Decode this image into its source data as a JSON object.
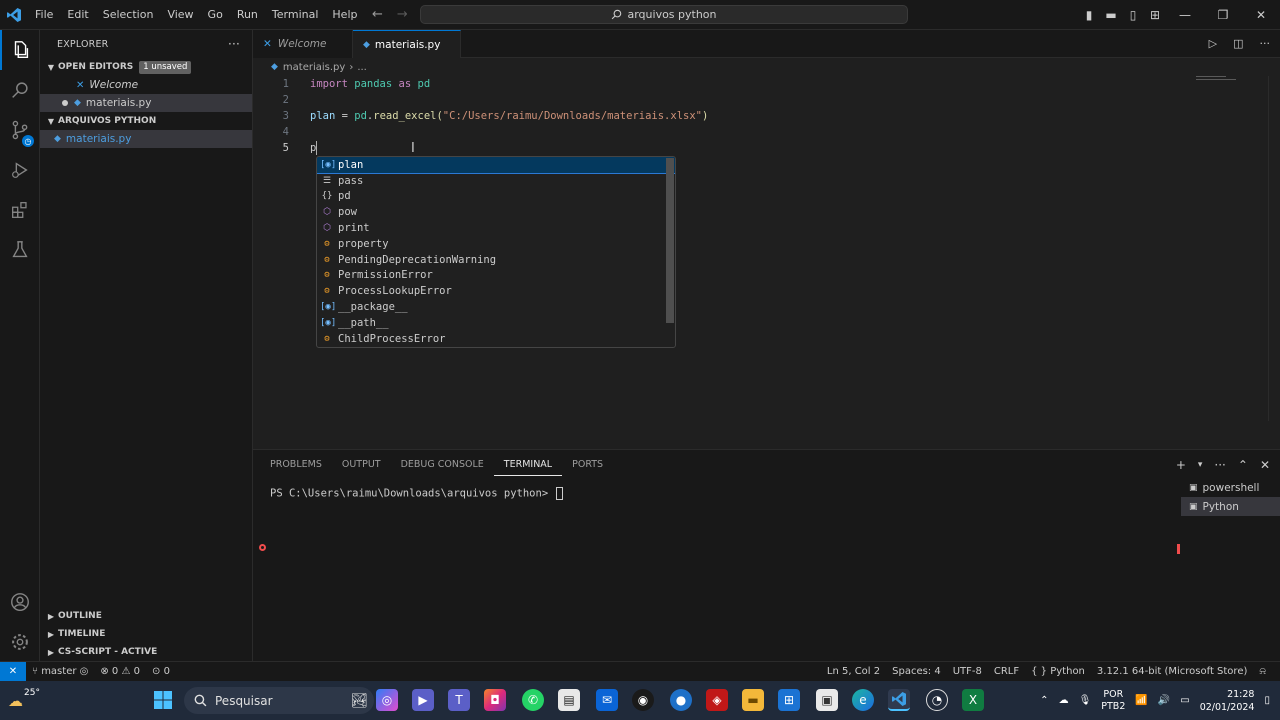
{
  "titlebar": {
    "menu": [
      "File",
      "Edit",
      "Selection",
      "View",
      "Go",
      "Run",
      "Terminal",
      "Help"
    ],
    "search": "arquivos python"
  },
  "sidebar": {
    "title": "EXPLORER",
    "open_editors": "OPEN EDITORS",
    "unsaved_badge": "1 unsaved",
    "open_files": [
      "Welcome",
      "materiais.py"
    ],
    "folder": "ARQUIVOS PYTHON",
    "folder_files": [
      "materiais.py"
    ],
    "outline": "OUTLINE",
    "timeline": "TIMELINE",
    "cs_script": "CS-SCRIPT - ACTIVE"
  },
  "editor": {
    "tabs": [
      "Welcome",
      "materiais.py"
    ],
    "breadcrumb": [
      "materiais.py",
      "..."
    ],
    "line_numbers": [
      "1",
      "2",
      "3",
      "4",
      "5"
    ],
    "line1": {
      "kw1": "import",
      "mod": "pandas",
      "kw2": "as",
      "alias": "pd"
    },
    "line3": {
      "var": "plan",
      "eq": " = ",
      "obj": "pd",
      "dot": ".",
      "fn": "read_excel",
      "open": "(",
      "str": "\"C:/Users/raimu/Downloads/materiais.xlsx\"",
      "close": ")"
    },
    "line5": "p"
  },
  "suggestions": [
    {
      "label": "plan",
      "icon": "variable-icon"
    },
    {
      "label": "pass",
      "icon": "keyword-icon"
    },
    {
      "label": "pd",
      "icon": "module-icon"
    },
    {
      "label": "pow",
      "icon": "function-icon"
    },
    {
      "label": "print",
      "icon": "function-icon"
    },
    {
      "label": "property",
      "icon": "class-icon"
    },
    {
      "label": "PendingDeprecationWarning",
      "icon": "class-icon"
    },
    {
      "label": "PermissionError",
      "icon": "class-icon"
    },
    {
      "label": "ProcessLookupError",
      "icon": "class-icon"
    },
    {
      "label": "__package__",
      "icon": "variable-icon"
    },
    {
      "label": "__path__",
      "icon": "variable-icon"
    },
    {
      "label": "ChildProcessError",
      "icon": "class-icon"
    }
  ],
  "panel": {
    "tabs": [
      "PROBLEMS",
      "OUTPUT",
      "DEBUG CONSOLE",
      "TERMINAL",
      "PORTS"
    ],
    "active_tab": "TERMINAL",
    "prompt": "PS C:\\Users\\raimu\\Downloads\\arquivos python> ",
    "terminals": [
      "powershell",
      "Python"
    ]
  },
  "status": {
    "branch": "master",
    "errors": "0",
    "warnings": "0",
    "ports": "0",
    "position": "Ln 5, Col 2",
    "spaces": "Spaces: 4",
    "encoding": "UTF-8",
    "eol": "CRLF",
    "language": "Python",
    "interpreter": "3.12.1 64-bit (Microsoft Store)"
  },
  "taskbar": {
    "temperature": "25°",
    "search": "Pesquisar",
    "lang1": "POR",
    "lang2": "PTB2",
    "time": "21:28",
    "date": "02/01/2024"
  },
  "colors": {
    "accent": "#0078d4",
    "keyword": "#c586c0",
    "string": "#ce9178",
    "function": "#dcdcaa",
    "variable": "#9cdcfe"
  }
}
